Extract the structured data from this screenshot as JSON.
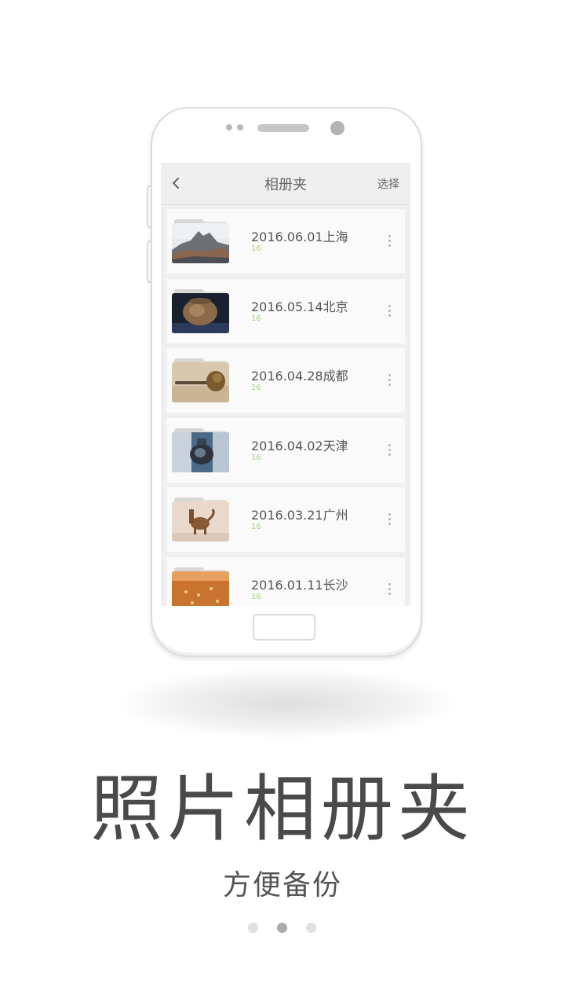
{
  "app": {
    "topbar": {
      "title": "相册夹",
      "select_label": "选择",
      "back_icon": "chevron-left-icon"
    },
    "albums": [
      {
        "name": "2016.06.01上海",
        "count": "16",
        "thumb": "mountain-photo"
      },
      {
        "name": "2016.05.14北京",
        "count": "16",
        "thumb": "pottery-jar-photo"
      },
      {
        "name": "2016.04.28成都",
        "count": "16",
        "thumb": "bronze-artifact-photo"
      },
      {
        "name": "2016.04.02天津",
        "count": "16",
        "thumb": "bronze-vessel-photo"
      },
      {
        "name": "2016.03.21广州",
        "count": "16",
        "thumb": "animal-figurine-photo"
      },
      {
        "name": "2016.01.11长沙",
        "count": "16",
        "thumb": "carved-stone-photo"
      }
    ]
  },
  "caption": {
    "title": "照片相册夹",
    "subtitle": "方便备份"
  },
  "pager": {
    "total": 3,
    "active_index": 1
  },
  "colors": {
    "count_green": "#9ed66d",
    "text_gray": "#555555",
    "pager_active": "#a9a9a9",
    "pager_inactive": "#e0e0e0"
  }
}
